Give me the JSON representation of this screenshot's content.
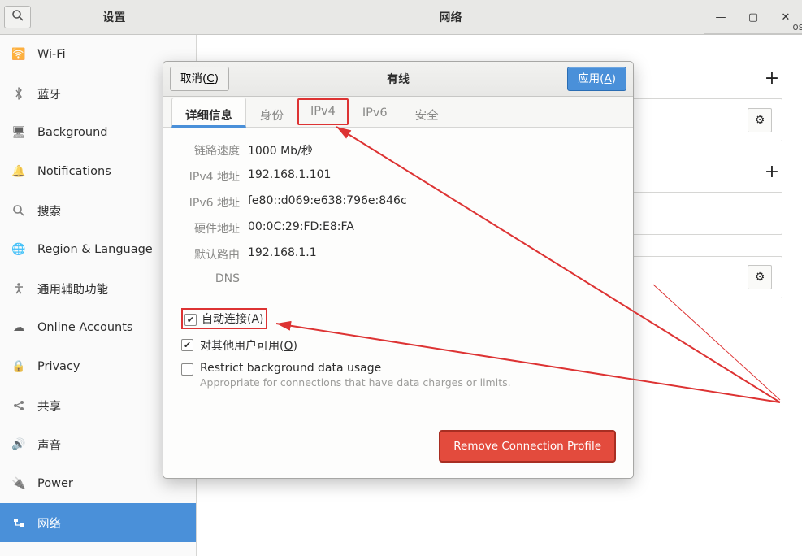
{
  "titlebar": {
    "left_title": "设置",
    "center_title": "网络",
    "truncated_right": "os"
  },
  "sidebar": {
    "items": [
      {
        "label": "Wi-Fi",
        "icon": "wifi"
      },
      {
        "label": "蓝牙",
        "icon": "bluetooth"
      },
      {
        "label": "Background",
        "icon": "background"
      },
      {
        "label": "Notifications",
        "icon": "bell"
      },
      {
        "label": "搜索",
        "icon": "search"
      },
      {
        "label": "Region & Language",
        "icon": "globe"
      },
      {
        "label": "通用辅助功能",
        "icon": "accessibility"
      },
      {
        "label": "Online Accounts",
        "icon": "online-accounts"
      },
      {
        "label": "Privacy",
        "icon": "lock"
      },
      {
        "label": "共享",
        "icon": "share"
      },
      {
        "label": "声音",
        "icon": "sound"
      },
      {
        "label": "Power",
        "icon": "power"
      },
      {
        "label": "网络",
        "icon": "network"
      }
    ]
  },
  "mainpane": {
    "plus": "+"
  },
  "dialog": {
    "cancel_label": "取消(",
    "cancel_key": "C",
    "cancel_close": ")",
    "title": "有线",
    "apply_label": "应用(",
    "apply_key": "A",
    "apply_close": ")",
    "tabs": {
      "details": "详细信息",
      "identity": "身份",
      "ipv4": "IPv4",
      "ipv6": "IPv6",
      "security": "安全"
    },
    "details": {
      "k_speed": "链路速度",
      "v_speed": "1000 Mb/秒",
      "k_ipv4": "IPv4 地址",
      "v_ipv4": "192.168.1.101",
      "k_ipv6": "IPv6 地址",
      "v_ipv6": "fe80::d069:e638:796e:846c",
      "k_hw": "硬件地址",
      "v_hw": "00:0C:29:FD:E8:FA",
      "k_route": "默认路由",
      "v_route": "192.168.1.1",
      "k_dns": "DNS",
      "v_dns": ""
    },
    "checkboxes": {
      "auto_pre": "自动连接(",
      "auto_key": "A",
      "auto_post": ")",
      "others_pre": "对其他用户可用(",
      "others_key": "O",
      "others_post": ")",
      "restrict_label": "Restrict background data usage",
      "restrict_sub": "Appropriate for connections that have data charges or limits."
    },
    "remove_label": "Remove Connection Profile"
  }
}
